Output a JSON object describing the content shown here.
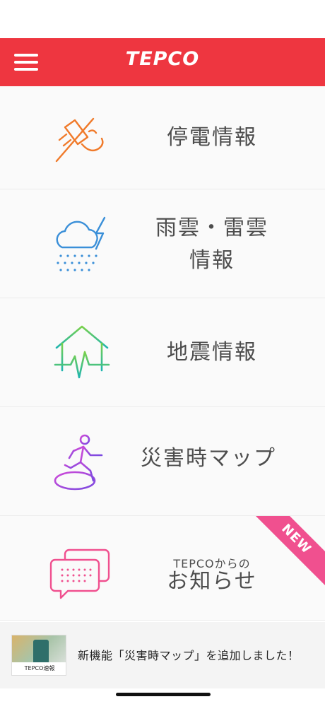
{
  "header": {
    "logo": "TEPCO",
    "menu_icon": "hamburger-menu-icon",
    "background_color": "#ee3640"
  },
  "menu": {
    "items": [
      {
        "label": "停電情報",
        "icon": "power-outage-plug-icon",
        "color": "#f07a2a"
      },
      {
        "label_line1": "雨雲・雷雲",
        "label_line2": "情報",
        "icon": "rain-thunder-cloud-icon",
        "color": "#3a8fd8"
      },
      {
        "label": "地震情報",
        "icon": "earthquake-house-icon",
        "color": "#2bc48a"
      },
      {
        "label": "災害時マップ",
        "icon": "evacuation-runner-icon",
        "color": "#b04ad8"
      },
      {
        "label_small": "TEPCOからの",
        "label": "お知らせ",
        "icon": "message-bubbles-icon",
        "color": "#f0508f",
        "badge": "NEW"
      }
    ]
  },
  "banner": {
    "text": "新機能「災害時マップ」を追加しました！",
    "thumbnail_caption": "TEPCO速報"
  }
}
